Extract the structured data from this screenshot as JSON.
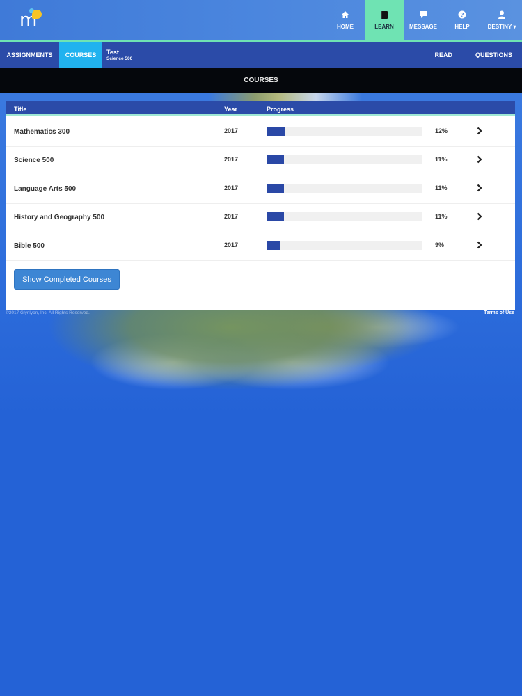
{
  "header": {
    "logo_alt": "m",
    "nav": [
      {
        "id": "home",
        "label": "HOME",
        "icon": "home-icon",
        "active": false
      },
      {
        "id": "learn",
        "label": "LEARN",
        "icon": "book-icon",
        "active": true
      },
      {
        "id": "message",
        "label": "MESSAGE",
        "icon": "chat-bubble-icon",
        "active": false
      },
      {
        "id": "help",
        "label": "HELP",
        "icon": "question-circle-icon",
        "active": false
      },
      {
        "id": "user",
        "label": "DESTINY",
        "icon": "user-icon",
        "active": false,
        "dropdown": true
      }
    ],
    "accent_color": "#6fe3b3"
  },
  "subnav": {
    "assignments_label": "ASSIGNMENTS",
    "courses_label": "COURSES",
    "context_title": "Test",
    "context_subtitle": "Science 500",
    "read_label": "READ",
    "questions_label": "QUESTIONS",
    "active_color": "#21b2ef"
  },
  "page": {
    "title": "COURSES"
  },
  "table": {
    "columns": [
      "Title",
      "Year",
      "Progress"
    ],
    "rows": [
      {
        "title": "Mathematics 300",
        "year": "2017",
        "progress": 12,
        "progress_label": "12%"
      },
      {
        "title": "Science 500",
        "year": "2017",
        "progress": 11,
        "progress_label": "11%"
      },
      {
        "title": "Language Arts 500",
        "year": "2017",
        "progress": 11,
        "progress_label": "11%"
      },
      {
        "title": "History and Geography 500",
        "year": "2017",
        "progress": 11,
        "progress_label": "11%"
      },
      {
        "title": "Bible 500",
        "year": "2017",
        "progress": 9,
        "progress_label": "9%"
      }
    ],
    "progress_color": "#2a48a6"
  },
  "actions": {
    "show_completed_label": "Show Completed Courses"
  },
  "footer": {
    "copyright": "©2017 Glynlyon, Inc. All Rights Reserved.",
    "terms_label": "Terms of Use"
  }
}
